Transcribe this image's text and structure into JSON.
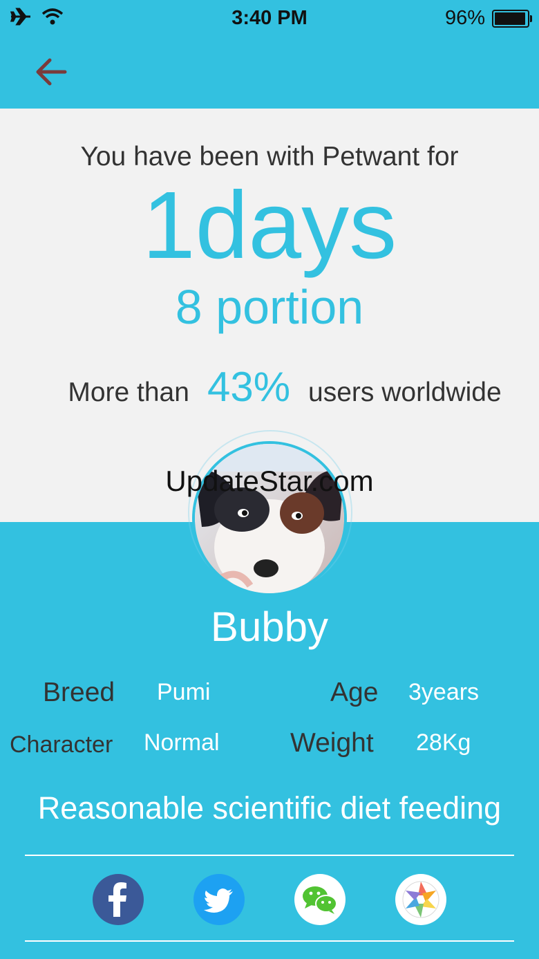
{
  "status_bar": {
    "time": "3:40 PM",
    "battery": "96%",
    "battery_level": 0.96
  },
  "stats": {
    "intro": "You have been with Petwant for",
    "days": "1days",
    "portion": "8 portion",
    "ranking_prefix": "More than",
    "ranking_percent": "43%",
    "ranking_suffix": "users worldwide"
  },
  "watermark": "UpdateStar.com",
  "pet": {
    "name": "Bubby",
    "breed_label": "Breed",
    "breed": "Pumi",
    "age_label": "Age",
    "age": "3years",
    "character_label": "Character",
    "character": "Normal",
    "weight_label": "Weight",
    "weight": "28Kg"
  },
  "slogan": "Reasonable scientific diet feeding",
  "share": {
    "facebook_icon": "facebook-icon",
    "twitter_icon": "twitter-icon",
    "wechat_icon": "wechat-icon",
    "moments_icon": "wechat-moments-icon"
  },
  "colors": {
    "accent": "#33c1e0",
    "panel": "#f2f2f2",
    "back_arrow": "#7a3b3b",
    "facebook": "#3b5998",
    "twitter": "#1da1f2",
    "wechat": "#51c332"
  }
}
